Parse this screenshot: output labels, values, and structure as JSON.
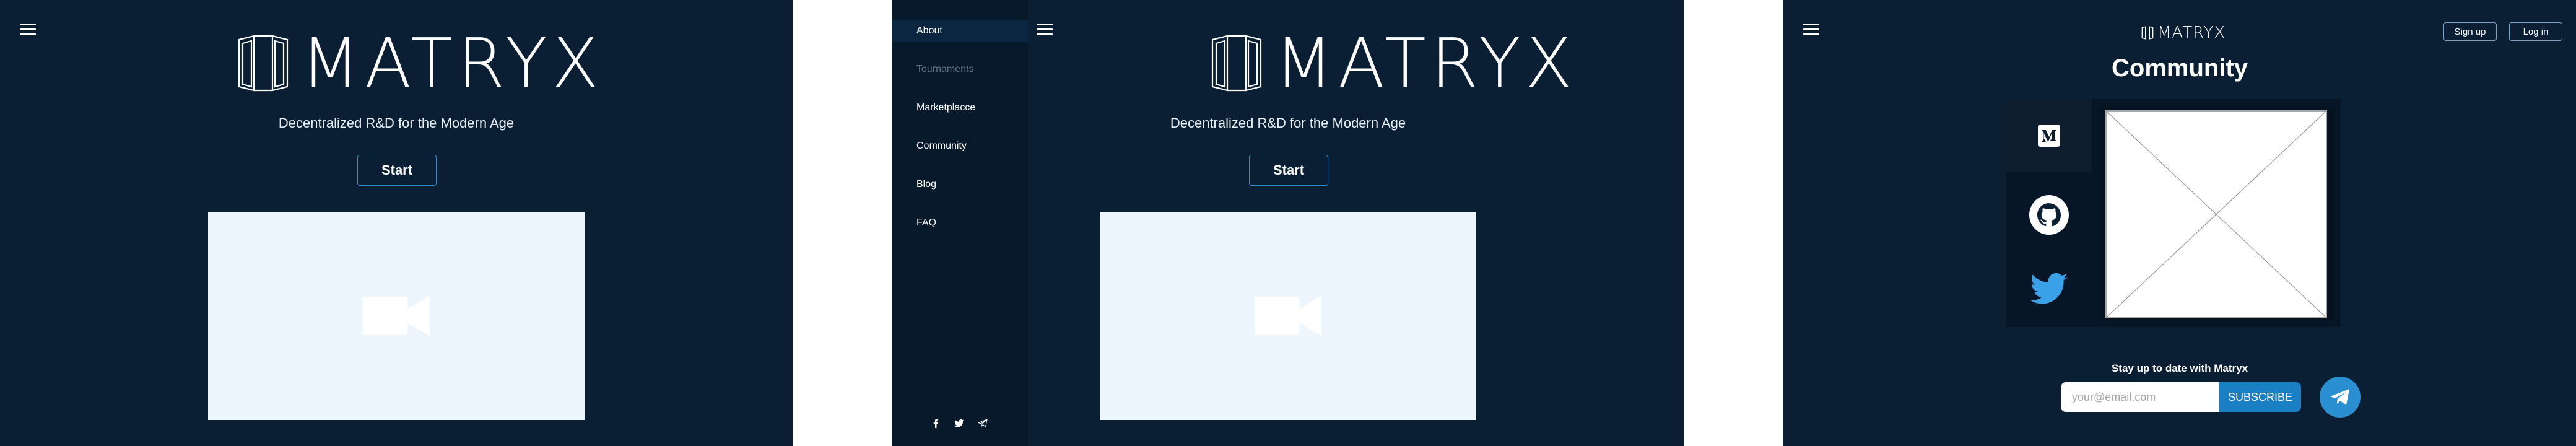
{
  "home": {
    "brand": "MATRYX",
    "tagline": "Decentralized R&D for the Modern Age",
    "start_label": "Start"
  },
  "menu": {
    "items": [
      {
        "label": "About",
        "state": "active"
      },
      {
        "label": "Tournaments",
        "state": "disabled"
      },
      {
        "label": "Marketplacce",
        "state": "normal"
      },
      {
        "label": "Community",
        "state": "normal"
      },
      {
        "label": "Blog",
        "state": "normal"
      },
      {
        "label": "FAQ",
        "state": "normal"
      }
    ],
    "social_icons": [
      "facebook-icon",
      "twitter-icon",
      "telegram-icon"
    ]
  },
  "community": {
    "brand": "MATRYX",
    "signup_label": "Sign up",
    "login_label": "Log in",
    "title": "Community",
    "tabs": [
      "medium-icon",
      "github-icon",
      "twitter-icon"
    ],
    "newsletter_heading": "Stay up to date with Matryx",
    "email_placeholder": "your@email.com",
    "subscribe_label": "SUBSCRIBE"
  },
  "colors": {
    "background": "#0a1f33",
    "accent": "#1b7fc4",
    "video_placeholder": "#eef6fd",
    "twitter": "#3aa1e8"
  }
}
